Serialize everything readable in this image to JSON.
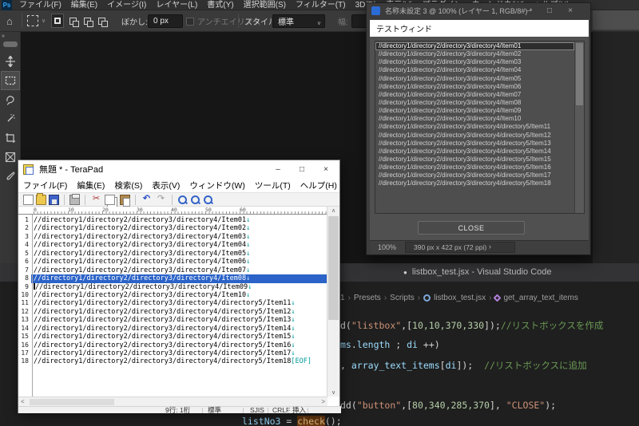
{
  "glyphs": {
    "min": "–",
    "max": "□",
    "close": "×",
    "up": "∧",
    "down": "∨",
    "left": "<",
    "right": ">",
    "chevron": "›",
    "separator": "›",
    "dot": "●",
    "collapse": "»",
    "dropdown": "∨",
    "home": "⌂"
  },
  "photoshop": {
    "logo_text": "Ps",
    "menu_items": [
      "ファイル(F)",
      "編集(E)",
      "イメージ(I)",
      "レイヤー(L)",
      "書式(Y)",
      "選択範囲(S)",
      "フィルター(T)",
      "3D(D)",
      "表示(V)",
      "プラグイン",
      "ウィンドウ(W)",
      "ヘルプ(H)"
    ],
    "options_bar": {
      "feather_label": "ぼかし:",
      "feather_value": "0 px",
      "antialias_label": "アンチエイリアス",
      "style_label": "スタイル:",
      "style_value": "標準",
      "width_label": "幅:"
    }
  },
  "script_window": {
    "title": "名称未設定 3 @ 100% (レイヤー 1, RGB/8#) *",
    "inner_title": "テストウィンド",
    "listbox_items": [
      "//directory1/directory2/directory3/directory4/Item01",
      "//directory1/directory2/directory3/directory4/Item02",
      "//directory1/directory2/directory3/directory4/Item03",
      "//directory1/directory2/directory3/directory4/Item04",
      "//directory1/directory2/directory3/directory4/Item05",
      "//directory1/directory2/directory3/directory4/Item06",
      "//directory1/directory2/directory3/directory4/Item07",
      "//directory1/directory2/directory3/directory4/Item08",
      "//directory1/directory2/directory3/directory4/Item09",
      "//directory1/directory2/directory3/directory4/Item10",
      "//directory1/directory2/directory3/directory4/directory5/Item11",
      "//directory1/directory2/directory3/directory4/directory5/Item12",
      "//directory1/directory2/directory3/directory4/directory5/Item13",
      "//directory1/directory2/directory3/directory4/directory5/Item14",
      "//directory1/directory2/directory3/directory4/directory5/Item15",
      "//directory1/directory2/directory3/directory4/directory5/Item16",
      "//directory1/directory2/directory3/directory4/directory5/Item17",
      "//directory1/directory2/directory3/directory4/directory5/Item18"
    ],
    "selected_index": 0,
    "close_label": "CLOSE",
    "status": {
      "zoom": "100%",
      "dimensions": "390 px x 422 px (72 ppi)"
    }
  },
  "terapad": {
    "title": "無題 * - TeraPad",
    "menu_items": [
      "ファイル(F)",
      "編集(E)",
      "検索(S)",
      "表示(V)",
      "ウィンドウ(W)",
      "ツール(T)",
      "ヘルプ(H)"
    ],
    "toolbar_glyphs": {
      "cut": "✂",
      "undo": "↶",
      "redo": "↷"
    },
    "ruler_numbers": [
      "0",
      "10",
      "20",
      "30",
      "40",
      "50",
      "60"
    ],
    "newline_symbol": "↓",
    "eof_marker": "[EOF]",
    "selected_line": 8,
    "lines": [
      "//directory1/directory2/directory3/directory4/Item01",
      "//directory1/directory2/directory3/directory4/Item02",
      "//directory1/directory2/directory3/directory4/Item03",
      "//directory1/directory2/directory3/directory4/Item04",
      "//directory1/directory2/directory3/directory4/Item05",
      "//directory1/directory2/directory3/directory4/Item06",
      "//directory1/directory2/directory3/directory4/Item07",
      "//directory1/directory2/directory3/directory4/Item08",
      "//directory1/directory2/directory3/directory4/Item09",
      "//directory1/directory2/directory3/directory4/Item10",
      "//directory1/directory2/directory3/directory4/directory5/Item11",
      "//directory1/directory2/directory3/directory4/directory5/Item12",
      "//directory1/directory2/directory3/directory4/directory5/Item13",
      "//directory1/directory2/directory3/directory4/directory5/Item14",
      "//directory1/directory2/directory3/directory4/directory5/Item15",
      "//directory1/directory2/directory3/directory4/directory5/Item16",
      "//directory1/directory2/directory3/directory4/directory5/Item17",
      "//directory1/directory2/directory3/directory4/directory5/Item18"
    ],
    "status": {
      "position": "9行: 1桁",
      "mode": "標準",
      "encoding": "SJIS",
      "linebreak": "CRLF",
      "insert": "挿入"
    }
  },
  "vscode": {
    "window_title": "listbox_test.jsx - Visual Studio Code",
    "breadcrumb": [
      "1",
      "Presets",
      "Scripts",
      "listbox_test.jsx",
      "get_array_text_items"
    ],
    "code_lines": [
      {
        "tokens": [
          {
            "t": "d(",
            "c": "p"
          },
          {
            "t": "\"listbox\"",
            "c": "s"
          },
          {
            "t": ",[",
            "c": "p"
          },
          {
            "t": "10,10,370,330",
            "c": "n"
          },
          {
            "t": "]);",
            "c": "p"
          },
          {
            "t": "//リストボックスを作成",
            "c": "c"
          }
        ]
      },
      {
        "tokens": [
          {
            "t": "ms",
            "c": "v"
          },
          {
            "t": ".",
            "c": "p"
          },
          {
            "t": "length",
            "c": "v"
          },
          {
            "t": " ; ",
            "c": "p"
          },
          {
            "t": "di",
            "c": "v"
          },
          {
            "t": " ++)",
            "c": "p"
          }
        ]
      },
      {
        "tokens": [
          {
            "t": ", ",
            "c": "p"
          },
          {
            "t": "array_text_items",
            "c": "v"
          },
          {
            "t": "[",
            "c": "p"
          },
          {
            "t": "di",
            "c": "v"
          },
          {
            "t": "]); ",
            "c": "p"
          },
          {
            "t": " //リストボックスに追加",
            "c": "c"
          }
        ]
      },
      {
        "tokens": [
          {
            "t": "dd(",
            "c": "p"
          },
          {
            "t": "\"button\"",
            "c": "s"
          },
          {
            "t": ",[",
            "c": "p"
          },
          {
            "t": "80,340,285,370",
            "c": "n"
          },
          {
            "t": "], ",
            "c": "p"
          },
          {
            "t": "\"CLOSE\"",
            "c": "s"
          },
          {
            "t": ");",
            "c": "p"
          }
        ]
      },
      {
        "tokens": [
          {
            "t": "listNo3 ",
            "c": "v"
          },
          {
            "t": "= ",
            "c": "p"
          },
          {
            "t": "check",
            "c": "m"
          },
          {
            "t": "();",
            "c": "p"
          }
        ]
      }
    ]
  }
}
